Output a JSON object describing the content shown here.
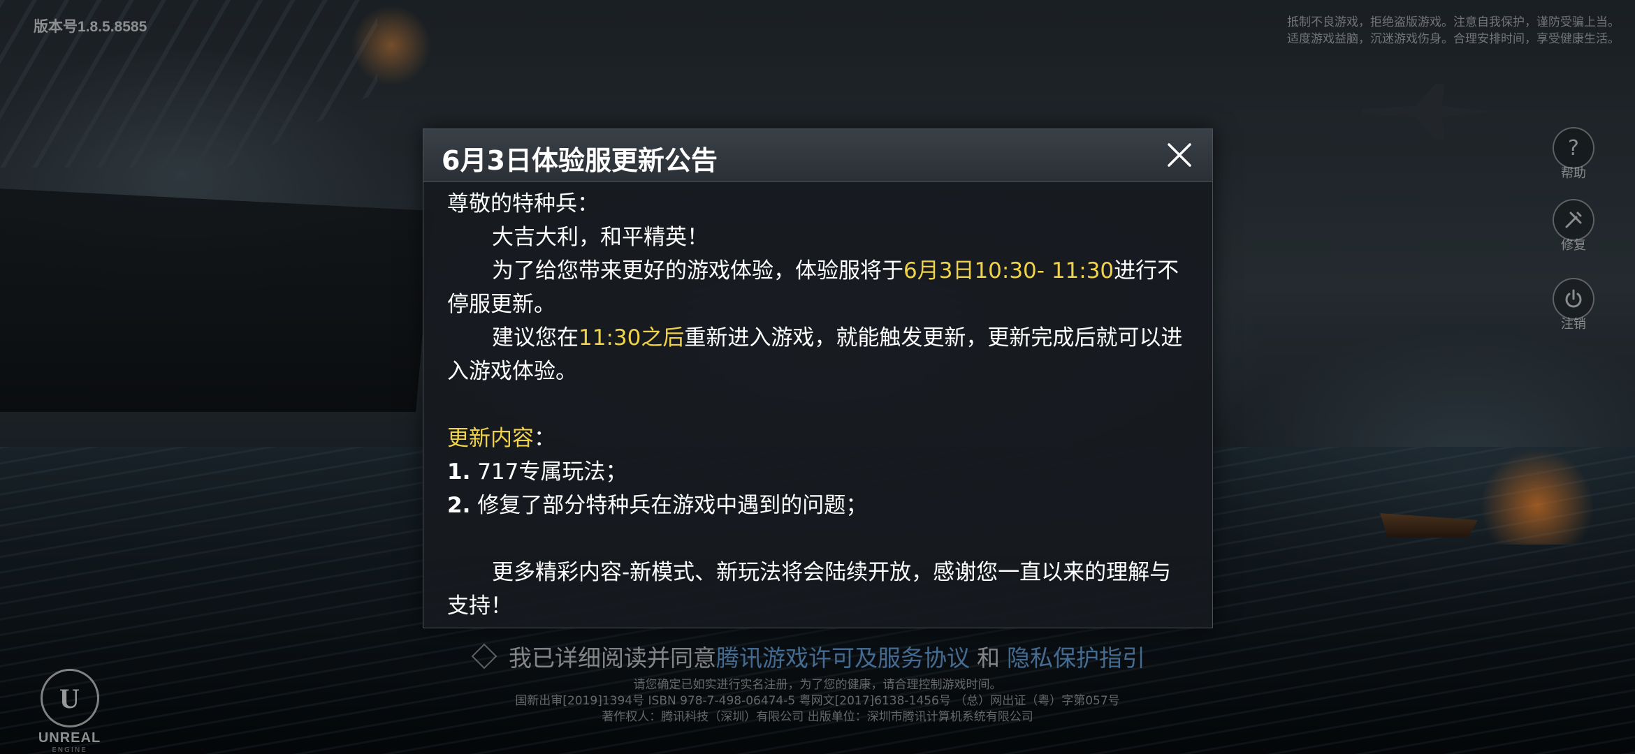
{
  "version": "版本号1.8.5.8585",
  "health_notice": {
    "line1": "抵制不良游戏，拒绝盗版游戏。注意自我保护，谨防受骗上当。",
    "line2": "适度游戏益脑，沉迷游戏伤身。合理安排时间，享受健康生活。"
  },
  "side_buttons": [
    {
      "label": "帮助",
      "icon": "question-icon"
    },
    {
      "label": "修复",
      "icon": "wrench-icon"
    },
    {
      "label": "注销",
      "icon": "power-icon"
    }
  ],
  "dialog": {
    "title": "6月3日体验服更新公告",
    "close_icon": "close-icon",
    "greeting": "尊敬的特种兵：",
    "salute": "大吉大利，和平精英！",
    "para1_a": "为了给您带来更好的游戏体验，体验服将于",
    "para1_highlight": "6月3日10:30- 11:30",
    "para1_b": "进行不停服更新。",
    "para2_a": "建议您在",
    "para2_highlight": "11:30之后",
    "para2_b": "重新进入游戏，就能触发更新，更新完成后就可以进入游戏体验。",
    "update_heading": "更新内容",
    "update_heading_colon": "：",
    "items": [
      {
        "num": "1.",
        "text": " 717专属玩法；"
      },
      {
        "num": "2.",
        "text": " 修复了部分特种兵在游戏中遇到的问题；"
      }
    ],
    "closing": "更多精彩内容-新模式、新玩法将会陆续开放，感谢您一直以来的理解与支持！"
  },
  "agreement": {
    "prefix": "我已详细阅读并同意",
    "link1": "腾讯游戏许可及服务协议",
    "and": "和",
    "link2": "隐私保护指引"
  },
  "legal": {
    "line1": "请您确定已如实进行实名注册，为了您的健康，请合理控制游戏时间。",
    "line2": "国新出审[2019]1394号  ISBN 978-7-498-06474-5  粤网文[2017]6138-1456号 （总）网出证（粤）字第057号",
    "line3": "著作权人：腾讯科技（深圳）有限公司  出版单位：深圳市腾讯计算机系统有限公司"
  },
  "engine_logo": {
    "mark": "U",
    "word": "UNREAL",
    "sub": "ENGINE"
  },
  "colors": {
    "highlight": "#f1d34a",
    "link": "#6eaae6",
    "dialog_bg": "#161a1f"
  }
}
